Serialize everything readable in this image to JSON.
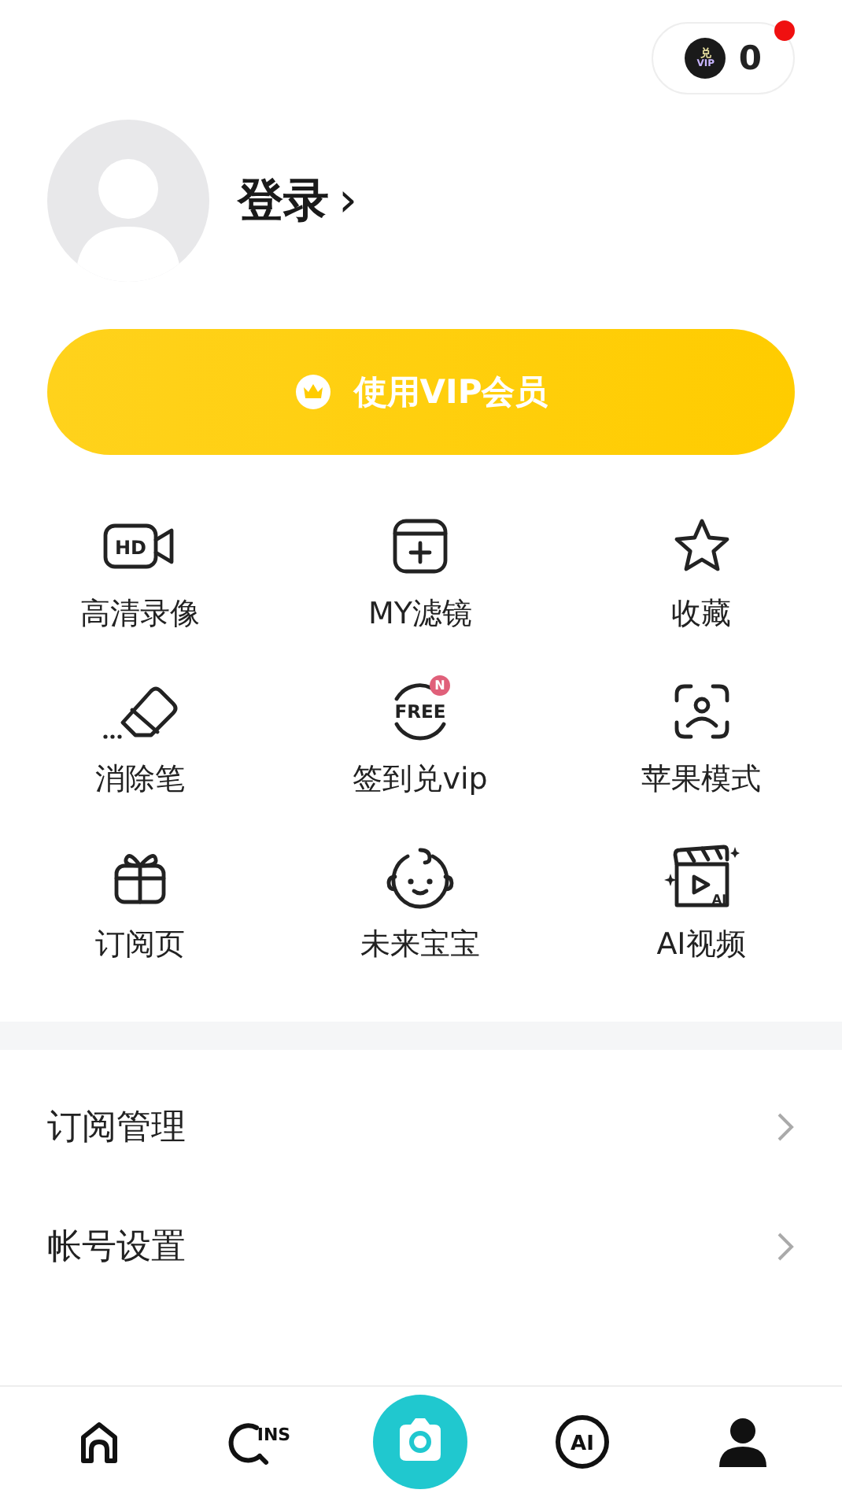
{
  "coin_badge": {
    "icon_text": [
      "兑",
      "VIP"
    ],
    "count": "0",
    "notification": true
  },
  "profile": {
    "login_label": "登录",
    "arrow": "›"
  },
  "vip_button": {
    "label": "使用VIP会员"
  },
  "features": [
    {
      "kind": "hd",
      "label": "高清录像",
      "icon_text": "HD"
    },
    {
      "kind": "filter",
      "label": "MY滤镜"
    },
    {
      "kind": "star",
      "label": "收藏"
    },
    {
      "kind": "eraser",
      "label": "消除笔"
    },
    {
      "kind": "free",
      "label": "签到兑vip",
      "icon_text": "FREE",
      "badge": "N"
    },
    {
      "kind": "face-scan",
      "label": "苹果模式"
    },
    {
      "kind": "gift",
      "label": "订阅页"
    },
    {
      "kind": "baby",
      "label": "未来宝宝"
    },
    {
      "kind": "clapboard",
      "label": "AI视频",
      "icon_text": "AI"
    }
  ],
  "menu": [
    {
      "label": "订阅管理"
    },
    {
      "label": "帐号设置"
    }
  ],
  "tab_bar": [
    {
      "kind": "home",
      "selected": false
    },
    {
      "kind": "ins",
      "icon_text": "INS",
      "selected": false
    },
    {
      "kind": "camera",
      "selected": false
    },
    {
      "kind": "ai",
      "icon_text": "AI",
      "selected": false
    },
    {
      "kind": "person",
      "selected": true
    }
  ]
}
